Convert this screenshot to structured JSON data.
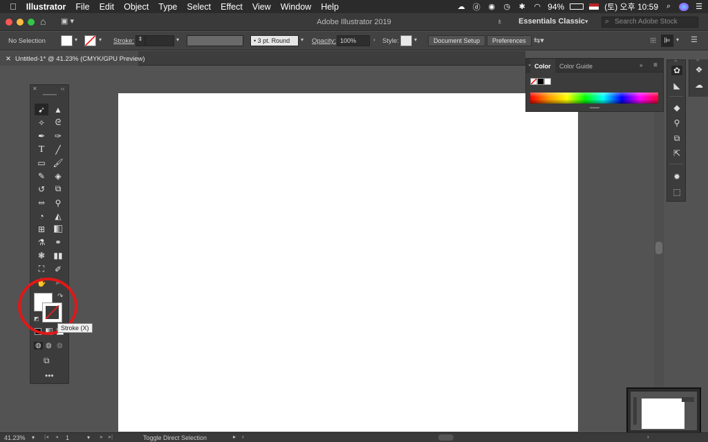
{
  "menubar": {
    "app_name": "Illustrator",
    "items": [
      "File",
      "Edit",
      "Object",
      "Type",
      "Select",
      "Effect",
      "View",
      "Window",
      "Help"
    ],
    "battery": "94%",
    "clock": "(토) 오후 10:59"
  },
  "appbar": {
    "title": "Adobe Illustrator 2019",
    "workspace": "Essentials Classic",
    "search_placeholder": "Search Adobe Stock"
  },
  "control_bar": {
    "selection_label": "No Selection",
    "stroke_label": "Stroke:",
    "brush_label": "3 pt. Round",
    "opacity_label": "Opacity:",
    "opacity_value": "100%",
    "style_label": "Style:",
    "document_setup": "Document Setup",
    "preferences": "Preferences"
  },
  "document": {
    "tab_title": "Untitled-1* @ 41.23% (CMYK/GPU Preview)"
  },
  "color_panel": {
    "tabs": [
      "Color",
      "Color Guide"
    ]
  },
  "tooltip": "Stroke (X)",
  "status_bar": {
    "zoom": "41.23%",
    "artboard_number": "1",
    "tool_hint": "Toggle Direct Selection"
  },
  "colors": {
    "highlight_circle": "#e01818",
    "artboard": "#ffffff",
    "workspace_bg": "#535353"
  }
}
